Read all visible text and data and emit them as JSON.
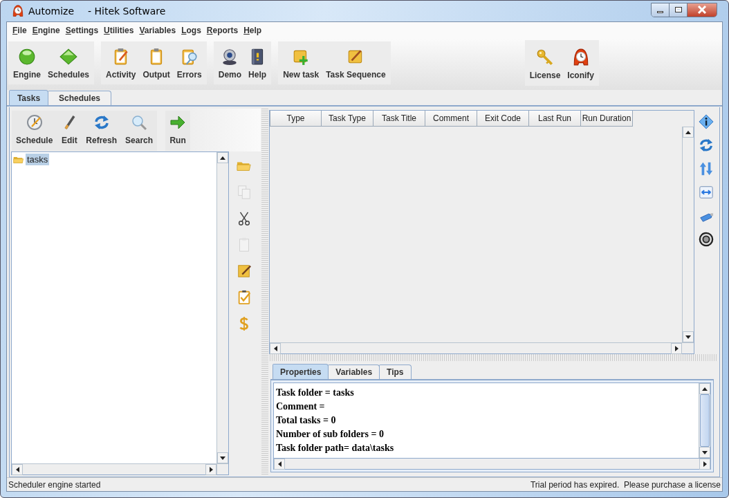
{
  "window": {
    "title": "Automize",
    "subtitle": "- Hitek Software"
  },
  "menu": [
    {
      "label": "File"
    },
    {
      "label": "Engine"
    },
    {
      "label": "Settings"
    },
    {
      "label": "Utilities"
    },
    {
      "label": "Variables"
    },
    {
      "label": "Logs"
    },
    {
      "label": "Reports"
    },
    {
      "label": "Help"
    }
  ],
  "toolbar": {
    "groups": [
      {
        "items": [
          {
            "label": "Engine"
          },
          {
            "label": "Schedules"
          }
        ]
      },
      {
        "items": [
          {
            "label": "Activity"
          },
          {
            "label": "Output"
          },
          {
            "label": "Errors"
          }
        ]
      },
      {
        "items": [
          {
            "label": "Demo"
          },
          {
            "label": "Help"
          }
        ]
      },
      {
        "items": [
          {
            "label": "New task"
          },
          {
            "label": "Task Sequence"
          }
        ]
      }
    ],
    "right_group": {
      "items": [
        {
          "label": "License"
        },
        {
          "label": "Iconify"
        }
      ]
    }
  },
  "tabs": [
    {
      "label": "Tasks",
      "selected": true
    },
    {
      "label": "Schedules",
      "selected": false
    }
  ],
  "task_toolbar": {
    "groups": [
      {
        "items": [
          {
            "label": "Schedule"
          },
          {
            "label": "Edit"
          },
          {
            "label": "Refresh"
          },
          {
            "label": "Search"
          }
        ]
      },
      {
        "items": [
          {
            "label": "Run"
          }
        ]
      }
    ]
  },
  "tree": [
    {
      "label": "tasks",
      "selected": true
    }
  ],
  "side_tools": [
    {
      "disabled": false
    },
    {
      "disabled": true
    },
    {
      "disabled": false
    },
    {
      "disabled": true
    },
    {
      "disabled": false
    },
    {
      "disabled": false
    },
    {
      "disabled": false
    }
  ],
  "table": {
    "columns": [
      "Type",
      "Task Type",
      "Task Title",
      "Comment",
      "Exit Code",
      "Last Run",
      "Run Duration"
    ]
  },
  "detail_tabs": [
    {
      "label": "Properties",
      "selected": true
    },
    {
      "label": "Variables",
      "selected": false
    },
    {
      "label": "Tips",
      "selected": false
    }
  ],
  "properties": [
    "Task folder = tasks",
    "Comment =",
    "Total tasks = 0",
    "Number of sub folders = 0",
    "Task folder path= data\\tasks"
  ],
  "status_bar": {
    "left": "Scheduler engine started",
    "right": "Trial period has expired.  Please purchase a license"
  }
}
